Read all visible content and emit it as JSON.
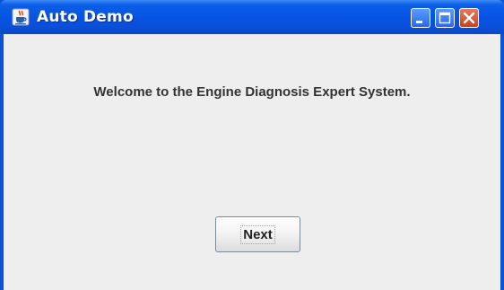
{
  "window": {
    "title": "Auto Demo",
    "icon": "java-coffee-cup-icon",
    "controls": {
      "minimize_icon": "minimize-icon",
      "maximize_icon": "maximize-icon",
      "close_icon": "close-icon"
    }
  },
  "main": {
    "welcome_text": "Welcome to the Engine Diagnosis Expert System.",
    "next_label": "Next"
  },
  "colors": {
    "titlebar": "#0654e4",
    "client_background": "#eeeeee",
    "close_button": "#d9572f"
  }
}
